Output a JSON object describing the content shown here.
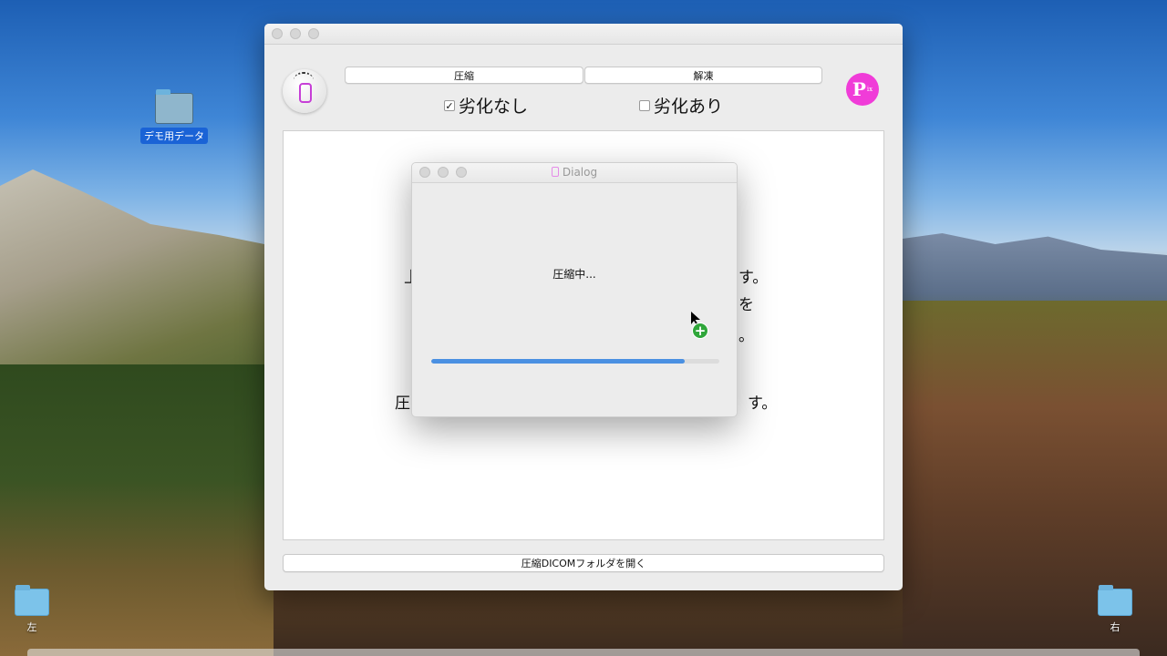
{
  "desktop": {
    "icons": [
      {
        "label": "デモ用データ"
      },
      {
        "label": "左"
      },
      {
        "label": "右"
      }
    ]
  },
  "window": {
    "compress_label": "圧縮",
    "decompress_label": "解凍",
    "lossless_label": "劣化なし",
    "lossy_label": "劣化あり",
    "lossless_checked": "✓",
    "logo_text": "P",
    "logo_sub": "ix",
    "open_folder_label": "圧縮DICOMフォルダを開く",
    "background_fragments": [
      "上",
      "す。",
      "を",
      "。",
      "圧",
      "す。"
    ]
  },
  "dialog": {
    "title": "Dialog",
    "status": "圧縮中...",
    "progress": 0.88
  },
  "colors": {
    "accent": "#4a90e2",
    "logo": "#f03cd8",
    "cursor_badge": "#2fa63a"
  }
}
